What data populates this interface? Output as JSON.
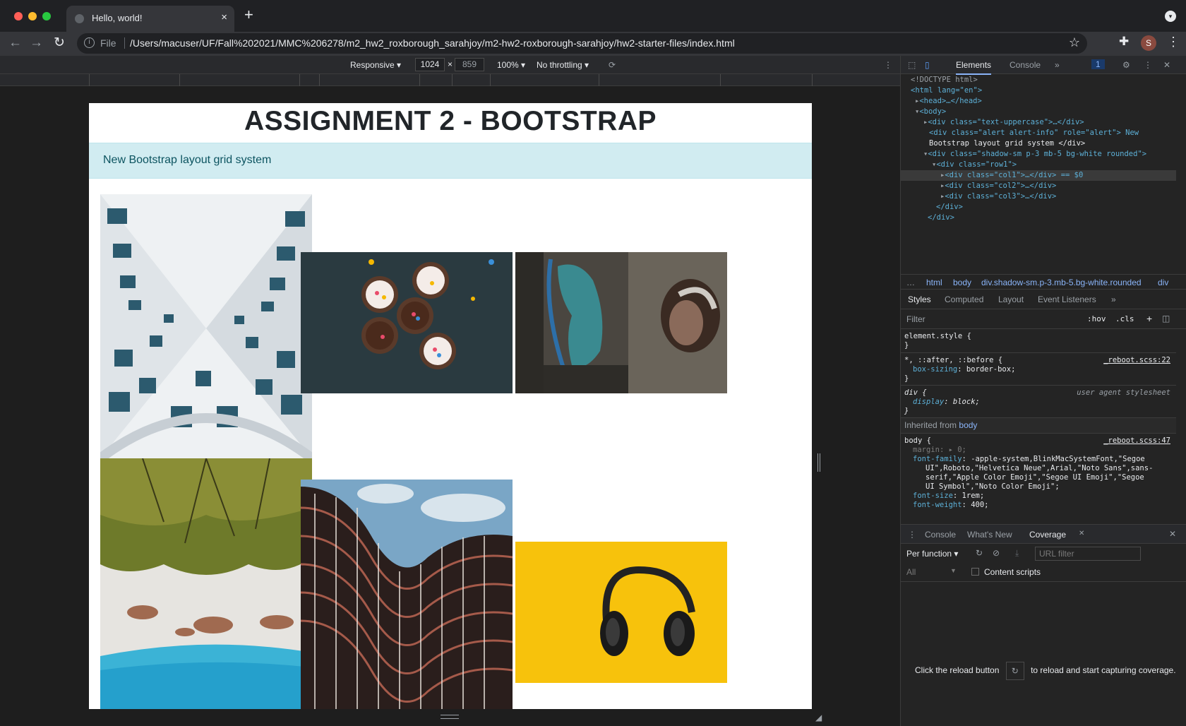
{
  "tab": {
    "title": "Hello, world!",
    "close": "×",
    "new": "+"
  },
  "toolbar": {
    "file_label": "File",
    "url": "/Users/macuser/UF/Fall%202021/MMC%206278/m2_hw2_roxborough_sarahjoy/m2-hw2-roxborough-sarahjoy/hw2-starter-files/index.html",
    "avatar_letter": "S"
  },
  "device_toolbar": {
    "mode": "Responsive ▾",
    "width": "1024",
    "times": "×",
    "height": "859",
    "zoom": "100% ▾",
    "throttle": "No throttling ▾"
  },
  "page": {
    "title": "ASSIGNMENT 2 - BOOTSTRAP",
    "alert": "New Bootstrap layout grid system",
    "images": [
      {
        "name": "building-looking-up-photo",
        "desc": "white building facade"
      },
      {
        "name": "cupcakes-photo",
        "desc": "cupcakes"
      },
      {
        "name": "graffiti-woman-photo",
        "desc": "graffiti wall"
      },
      {
        "name": "palm-trees-beach-photo",
        "desc": "palm trees beach"
      },
      {
        "name": "curved-building-photo",
        "desc": "curved building"
      },
      {
        "name": "headphones-yellow-photo",
        "desc": "headphones"
      }
    ]
  },
  "devtools": {
    "tabs": {
      "elements": "Elements",
      "console": "Console",
      "more": "»",
      "badge": "1"
    },
    "dom": [
      "<!DOCTYPE html>",
      "<html lang=\"en\">",
      "<head>…</head>",
      "<body>",
      "<div class=\"text-uppercase\">…</div>",
      "<div class=\"alert alert-info\" role=\"alert\"> New",
      "Bootstrap layout grid system </div>",
      "<div class=\"shadow-sm p-3 mb-5 bg-white rounded\">",
      "<div class=\"row1\">",
      "<div class=\"col1\">…</div> == $0",
      "<div class=\"col2\">…</div>",
      "<div class=\"col3\">…</div>",
      "</div>",
      "</div>"
    ],
    "crumbs": [
      "html",
      "body",
      "div.shadow-sm.p-3.mb-5.bg-white.rounded",
      "div"
    ],
    "style_tabs": [
      "Styles",
      "Computed",
      "Layout",
      "Event Listeners",
      "»"
    ],
    "filter": {
      "placeholder": "Filter",
      "hov": ":hov",
      "cls": ".cls",
      "plus": "+"
    },
    "rules": {
      "r1_selector": "element.style {",
      "r1_close": "}",
      "r2_selector": "*, ::after, ::before {",
      "r2_source": "_reboot.scss:22",
      "r2_prop": "box-sizing",
      "r2_val": ": border-box;",
      "r2_close": "}",
      "r3_selector": "div {",
      "r3_source": "user agent stylesheet",
      "r3_prop": "display",
      "r3_val": ": block;",
      "r3_close": "}",
      "inherited_label": "Inherited from",
      "inherited_from": "body",
      "r4_selector": "body {",
      "r4_source": "_reboot.scss:47",
      "r4_margin": "margin",
      "r4_margin_val": ": ▸ 0;",
      "r4_ff": "font-family",
      "r4_ff_val1": ": -apple-system,BlinkMacSystemFont,\"Segoe",
      "r4_ff_val2": "UI\",Roboto,\"Helvetica Neue\",Arial,\"Noto Sans\",sans-",
      "r4_ff_val3": "serif,\"Apple Color Emoji\",\"Segoe UI Emoji\",\"Segoe",
      "r4_ff_val4": "UI Symbol\",\"Noto Color Emoji\";",
      "r4_fs": "font-size",
      "r4_fs_val": ": 1rem;",
      "r4_fw": "font-weight",
      "r4_fw_val": ": 400;"
    },
    "drawer": {
      "tabs": [
        "Console",
        "What's New",
        "Coverage"
      ],
      "per_function": "Per function ▾",
      "url_filter": "URL filter",
      "all": "All",
      "content_scripts": "Content scripts",
      "msg1": "Click the reload button",
      "msg2": "to reload and start capturing coverage."
    }
  }
}
